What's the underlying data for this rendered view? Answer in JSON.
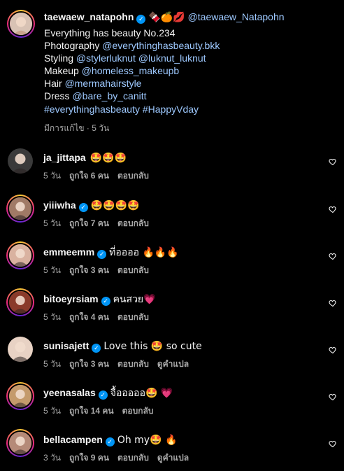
{
  "caption": {
    "username": "taewaew_natapohn",
    "emoji_after_name": "🍫🍊💋",
    "mention": "@taewaew_Natapohn",
    "lines": [
      {
        "label": "Everything has beauty No.234",
        "link": ""
      },
      {
        "label": "Photography ",
        "link": "@everythinghasbeauty.bkk"
      },
      {
        "label": "Styling ",
        "link": "@stylerluknut @luknut_luknut"
      },
      {
        "label": "Makeup ",
        "link": "@homeless_makeupb"
      },
      {
        "label": "Hair ",
        "link": "@mermahairstyle"
      },
      {
        "label": "Dress ",
        "link": "@bare_by_canitt"
      },
      {
        "label": "",
        "link": "#everythinghasbeauty #HappyVday"
      }
    ],
    "edited_meta": "มีการแก้ไข · 5 วัน"
  },
  "comments": [
    {
      "username": "ja_jittapa",
      "verified": false,
      "text": "🤩🤩🤩",
      "time": "5 วัน",
      "likes": "ถูกใจ 6 คน",
      "reply": "ตอบกลับ",
      "translate": "",
      "ring": false,
      "avatar_color": "#3a3a3a"
    },
    {
      "username": "yiiiwha",
      "verified": true,
      "text": "🤩🤩🤩🤩",
      "time": "5 วัน",
      "likes": "ถูกใจ 7 คน",
      "reply": "ตอบกลับ",
      "translate": "",
      "ring": true,
      "avatar_color": "#a07a66"
    },
    {
      "username": "emmeemm",
      "verified": true,
      "text": "ที่ออออ 🔥🔥🔥",
      "time": "5 วัน",
      "likes": "ถูกใจ 3 คน",
      "reply": "ตอบกลับ",
      "translate": "",
      "ring": true,
      "avatar_color": "#d9b2a0"
    },
    {
      "username": "bitoeyrsiam",
      "verified": true,
      "text": "คนสวย💗",
      "time": "5 วัน",
      "likes": "ถูกใจ 4 คน",
      "reply": "ตอบกลับ",
      "translate": "",
      "ring": true,
      "avatar_color": "#8a3a2a"
    },
    {
      "username": "sunisajett",
      "verified": true,
      "text": "Love this 🤩 so cute",
      "time": "5 วัน",
      "likes": "ถูกใจ 3 คน",
      "reply": "ตอบกลับ",
      "translate": "ดูคำแปล",
      "ring": false,
      "avatar_color": "#e8d2c4"
    },
    {
      "username": "yeenasalas",
      "verified": true,
      "text": "จื้อออออ🤩 💗",
      "time": "5 วัน",
      "likes": "ถูกใจ 14 คน",
      "reply": "ตอบกลับ",
      "translate": "",
      "ring": true,
      "avatar_color": "#c49a6c"
    },
    {
      "username": "bellacampen",
      "verified": true,
      "text": "Oh my🤩 🔥",
      "time": "3 วัน",
      "likes": "ถูกใจ 9 คน",
      "reply": "ตอบกลับ",
      "translate": "ดูคำแปล",
      "ring": true,
      "avatar_color": "#b58a78"
    }
  ],
  "colors": {
    "background": "#000000",
    "verified": "#0095f6",
    "link": "#e0f1ff",
    "meta": "#a8a8a8"
  }
}
